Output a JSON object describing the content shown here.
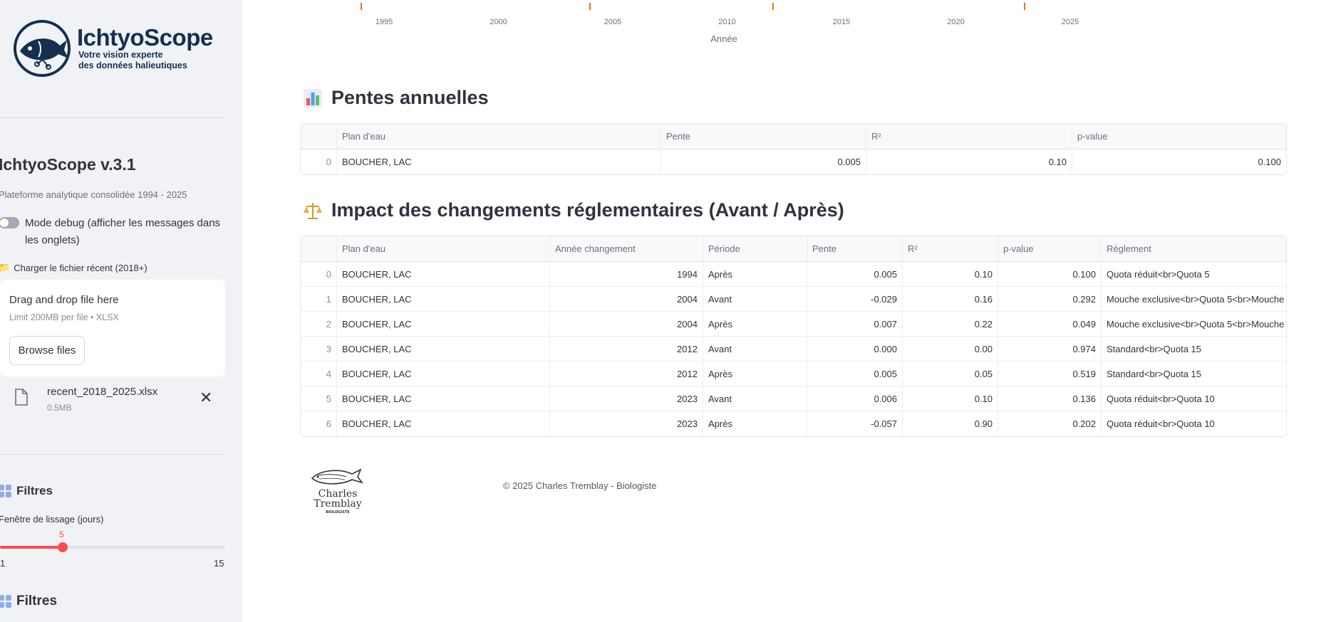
{
  "sidebar": {
    "logo": {
      "title": "IchtyoScope",
      "subtitle_line1": "Votre vision experte",
      "subtitle_line2": "des données halieutiques"
    },
    "app_version": "IchtyoScope v.3.1",
    "app_description": "Plateforme analytique consolidée 1994 - 2025",
    "debug_toggle_label": "Mode debug (afficher les messages dans les onglets)",
    "upload": {
      "label": "Charger le fichier récent (2018+)",
      "dropzone_title": "Drag and drop file here",
      "dropzone_limit": "Limit 200MB per file • XLSX",
      "browse_label": "Browse files",
      "file_name": "recent_2018_2025.xlsx",
      "file_size": "0.5MB"
    },
    "filters_title_1": "Filtres",
    "slider": {
      "label": "Fenêtre de lissage (jours)",
      "value": "5",
      "min": "1",
      "max": "15"
    },
    "filters_title_2": "Filtres"
  },
  "chart_axis": {
    "ticks": [
      "1995",
      "2000",
      "2005",
      "2010",
      "2015",
      "2020",
      "2025"
    ],
    "xlabel": "Année",
    "markers": [
      1994,
      2004,
      2012,
      2023
    ]
  },
  "slopes": {
    "title": "Pentes annuelles",
    "headers": [
      "",
      "Plan d'eau",
      "Pente",
      "R²",
      "p-value"
    ],
    "rows": [
      {
        "index": "0",
        "plan": "BOUCHER, LAC",
        "pente": "0.005",
        "r2": "0.10",
        "pvalue": "0.100"
      }
    ]
  },
  "impact": {
    "title": "Impact des changements réglementaires (Avant / Après)",
    "headers": [
      "",
      "Plan d'eau",
      "Année changement",
      "Période",
      "Pente",
      "R²",
      "p-value",
      "Règlement"
    ],
    "rows": [
      {
        "index": "0",
        "plan": "BOUCHER, LAC",
        "annee": "1994",
        "periode": "Après",
        "pente": "0.005",
        "r2": "0.10",
        "pvalue": "0.100",
        "reglement": "Quota réduit<br>Quota 5"
      },
      {
        "index": "1",
        "plan": "BOUCHER, LAC",
        "annee": "2004",
        "periode": "Avant",
        "pente": "-0.029",
        "r2": "0.16",
        "pvalue": "0.292",
        "reglement": "Mouche exclusive<br>Quota 5<br>Mouche"
      },
      {
        "index": "2",
        "plan": "BOUCHER, LAC",
        "annee": "2004",
        "periode": "Après",
        "pente": "0.007",
        "r2": "0.22",
        "pvalue": "0.049",
        "reglement": "Mouche exclusive<br>Quota 5<br>Mouche"
      },
      {
        "index": "3",
        "plan": "BOUCHER, LAC",
        "annee": "2012",
        "periode": "Avant",
        "pente": "0.000",
        "r2": "0.00",
        "pvalue": "0.974",
        "reglement": "Standard<br>Quota 15"
      },
      {
        "index": "4",
        "plan": "BOUCHER, LAC",
        "annee": "2012",
        "periode": "Après",
        "pente": "0.005",
        "r2": "0.05",
        "pvalue": "0.519",
        "reglement": "Standard<br>Quota 15"
      },
      {
        "index": "5",
        "plan": "BOUCHER, LAC",
        "annee": "2023",
        "periode": "Avant",
        "pente": "0.006",
        "r2": "0.10",
        "pvalue": "0.136",
        "reglement": "Quota réduit<br>Quota 10"
      },
      {
        "index": "6",
        "plan": "BOUCHER, LAC",
        "annee": "2023",
        "periode": "Après",
        "pente": "-0.057",
        "r2": "0.90",
        "pvalue": "0.202",
        "reglement": "Quota réduit<br>Quota 10"
      }
    ]
  },
  "footer": {
    "logo_line1": "Charles",
    "logo_line2": "Tremblay",
    "logo_line3": "BIOLOGISTE",
    "text": "© 2025 Charles Tremblay - Biologiste"
  },
  "colors": {
    "positive": "#1f8a2e",
    "negative": "#d7191c",
    "accent": "#ff4b4b",
    "brand": "#15304f",
    "marker": "#e8710a"
  },
  "icons": {
    "section_slopes": "bar-chart-icon",
    "section_impact": "balance-scale-icon",
    "filters": "grid-icon",
    "file": "file-icon",
    "close": "close-icon"
  }
}
